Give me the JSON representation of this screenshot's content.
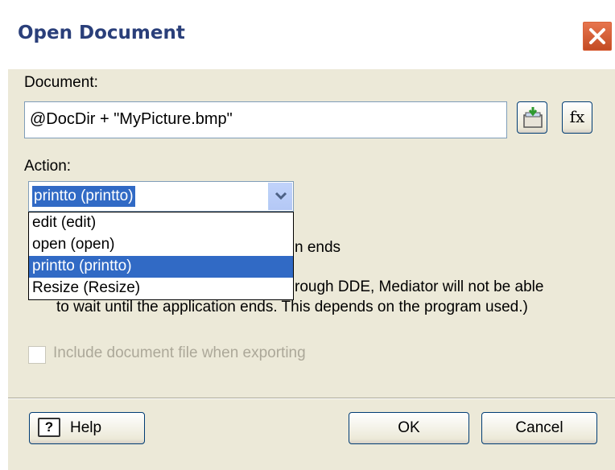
{
  "window": {
    "title": "Open Document"
  },
  "document": {
    "label": "Document:",
    "value": "@DocDir + \"MyPicture.bmp\"",
    "fx_label": "fx"
  },
  "action": {
    "label": "Action:",
    "selected": "printto (printto)",
    "options": [
      "edit (edit)",
      "open (open)",
      "printto (printto)",
      "Resize (Resize)"
    ]
  },
  "notes": {
    "line1_fragment": "n ends",
    "line2_fragment": "rough DDE, Mediator will not be able",
    "line3": "to wait until the application ends. This depends on the program used.)"
  },
  "checkbox": {
    "label": "Include document file when exporting",
    "checked": false,
    "enabled": false
  },
  "buttons": {
    "help": "Help",
    "ok": "OK",
    "cancel": "Cancel"
  },
  "colors": {
    "selection": "#316ac5",
    "dialog_bg": "#ece9d8",
    "title_text": "#2a3f7a",
    "close_button": "#d9623a"
  }
}
